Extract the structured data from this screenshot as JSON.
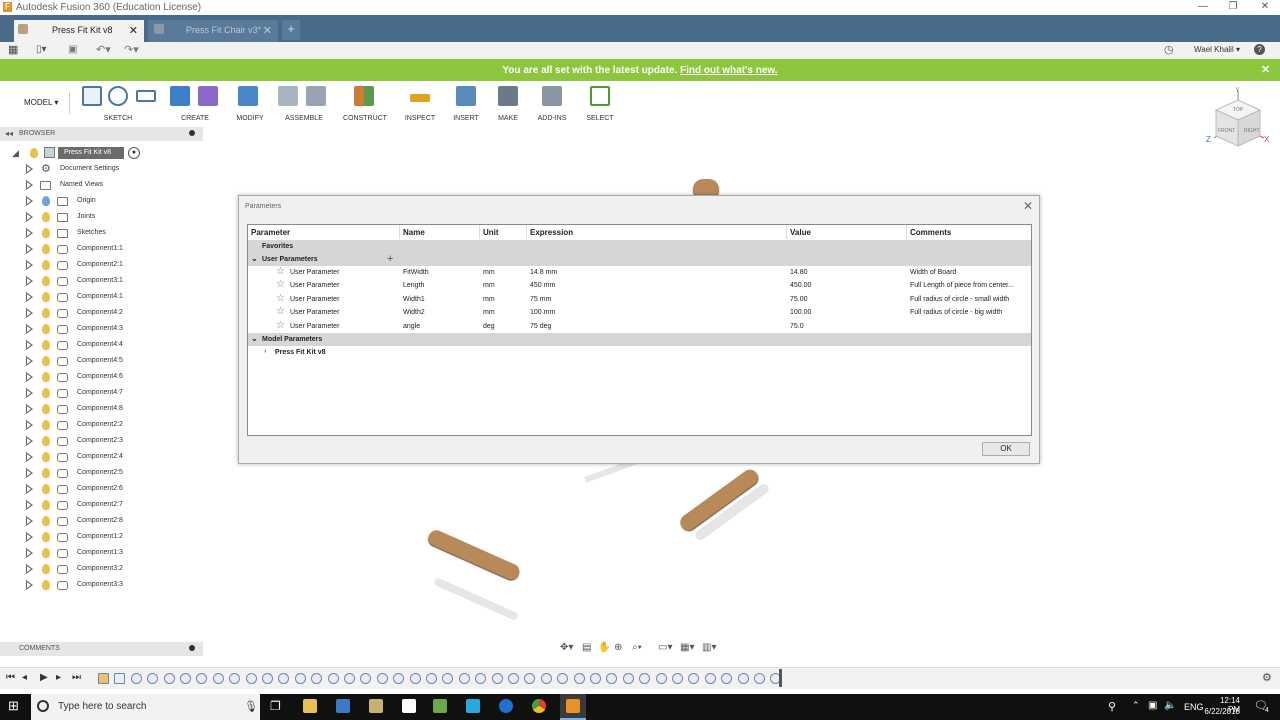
{
  "window": {
    "title": "Autodesk Fusion 360 (Education License)"
  },
  "tabs": [
    {
      "label": "Press Fit Kit v8",
      "active": true
    },
    {
      "label": "Press Fit Chair v3*",
      "active": false
    }
  ],
  "user": {
    "name": "Wael Khalil"
  },
  "banner": {
    "message": "You are all set with the latest update.",
    "link": "Find out what's new."
  },
  "toolbar": {
    "mode": "MODEL",
    "groups": [
      "SKETCH",
      "CREATE",
      "MODIFY",
      "ASSEMBLE",
      "CONSTRUCT",
      "INSPECT",
      "INSERT",
      "MAKE",
      "ADD-INS",
      "SELECT"
    ]
  },
  "viewcube": {
    "top": "TOP",
    "front": "FRONT",
    "right": "RIGHT"
  },
  "browser": {
    "title": "BROWSER",
    "root": "Press Fit Kit v8",
    "items": [
      {
        "label": "Document Settings",
        "icon": "gear-icon"
      },
      {
        "label": "Named Views",
        "icon": "folder-icon"
      },
      {
        "label": "Origin",
        "icon": "folder-icon",
        "bulb": "blue"
      },
      {
        "label": "Joints",
        "icon": "folder-icon"
      },
      {
        "label": "Sketches",
        "icon": "folder-icon"
      },
      {
        "label": "Component1:1",
        "icon": "component-icon"
      },
      {
        "label": "Component2:1",
        "icon": "component-icon"
      },
      {
        "label": "Component3:1",
        "icon": "component-icon"
      },
      {
        "label": "Component4:1",
        "icon": "component-icon"
      },
      {
        "label": "Component4:2",
        "icon": "component-icon"
      },
      {
        "label": "Component4:3",
        "icon": "component-icon"
      },
      {
        "label": "Component4:4",
        "icon": "component-icon"
      },
      {
        "label": "Component4:5",
        "icon": "component-icon"
      },
      {
        "label": "Component4:6",
        "icon": "component-icon"
      },
      {
        "label": "Component4:7",
        "icon": "component-icon"
      },
      {
        "label": "Component4:8",
        "icon": "component-icon"
      },
      {
        "label": "Component2:2",
        "icon": "component-icon"
      },
      {
        "label": "Component2:3",
        "icon": "component-icon"
      },
      {
        "label": "Component2:4",
        "icon": "component-icon"
      },
      {
        "label": "Component2:5",
        "icon": "component-icon"
      },
      {
        "label": "Component2:6",
        "icon": "component-icon"
      },
      {
        "label": "Component2:7",
        "icon": "component-icon"
      },
      {
        "label": "Component2:8",
        "icon": "component-icon"
      },
      {
        "label": "Component1:2",
        "icon": "component-icon"
      },
      {
        "label": "Component1:3",
        "icon": "component-icon"
      },
      {
        "label": "Component3:2",
        "icon": "component-icon"
      },
      {
        "label": "Component3:3",
        "icon": "component-icon"
      }
    ]
  },
  "dialog": {
    "title": "Parameters",
    "columns": [
      "Parameter",
      "Name",
      "Unit",
      "Expression",
      "Value",
      "Comments"
    ],
    "favorites_label": "Favorites",
    "user_section": "User Parameters",
    "rows": [
      {
        "parameter": "User Parameter",
        "name": "FitWidth",
        "unit": "mm",
        "expression": "14.8 mm",
        "value": "14.80",
        "comment": "Width of Board"
      },
      {
        "parameter": "User Parameter",
        "name": "Length",
        "unit": "mm",
        "expression": "450 mm",
        "value": "450.00",
        "comment": "Full Length of piece from center..."
      },
      {
        "parameter": "User Parameter",
        "name": "Width1",
        "unit": "mm",
        "expression": "75 mm",
        "value": "75.00",
        "comment": "Full radius of circle - small width"
      },
      {
        "parameter": "User Parameter",
        "name": "Width2",
        "unit": "mm",
        "expression": "100 mm",
        "value": "100.00",
        "comment": "Full radius of circle - big width"
      },
      {
        "parameter": "User Parameter",
        "name": "angle",
        "unit": "deg",
        "expression": "75 deg",
        "value": "75.0",
        "comment": ""
      }
    ],
    "model_section": "Model Parameters",
    "model_item": "Press Fit Kit v8",
    "ok_label": "OK"
  },
  "comments_panel": {
    "title": "COMMENTS"
  },
  "taskbar": {
    "search_placeholder": "Type here to search",
    "language": "ENG",
    "time": "12:14 PM",
    "date": "6/22/2018",
    "notification_count": "4"
  },
  "colors": {
    "banner": "#8cc63f",
    "tabbar": "#4a6a8a",
    "wood": "#b88a5a",
    "taskbar": "#101010"
  }
}
